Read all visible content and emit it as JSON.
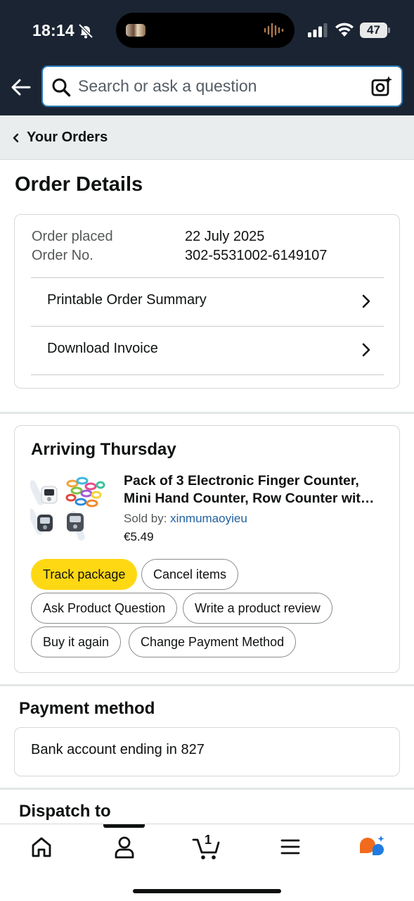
{
  "status_bar": {
    "time": "18:14",
    "battery": "47"
  },
  "search": {
    "placeholder": "Search or ask a question"
  },
  "breadcrumb": {
    "label": "Your Orders"
  },
  "page": {
    "title": "Order Details"
  },
  "order": {
    "placed_label": "Order placed",
    "placed_value": "22 July 2025",
    "number_label": "Order No.",
    "number_value": "302-5531002-6149107",
    "links": [
      "Printable Order Summary",
      "Download Invoice"
    ]
  },
  "shipment": {
    "status": "Arriving Thursday",
    "product": {
      "title_line1": "Pack of 3 Electronic Finger Counter,",
      "title_line2": "Mini Hand Counter, Row Counter wit…",
      "sold_by_label": "Sold by:",
      "seller": "xinmumaoyieu",
      "price": "€5.49"
    },
    "actions": {
      "track": "Track package",
      "cancel": "Cancel items",
      "ask": "Ask Product Question",
      "review": "Write a product review",
      "buy_again": "Buy it again",
      "change_payment": "Change Payment Method"
    }
  },
  "payment": {
    "heading": "Payment method",
    "text": "Bank account ending in 827"
  },
  "dispatch": {
    "heading": "Dispatch to"
  },
  "nav": {
    "cart_count": "1",
    "items": [
      "home-icon",
      "account-icon",
      "cart-icon",
      "menu-icon",
      "rufus-icon"
    ]
  },
  "colors": {
    "header_bg": "#1b2433",
    "primary_button": "#ffd814",
    "link": "#2162a1",
    "crumb_bg": "#eaeded"
  }
}
